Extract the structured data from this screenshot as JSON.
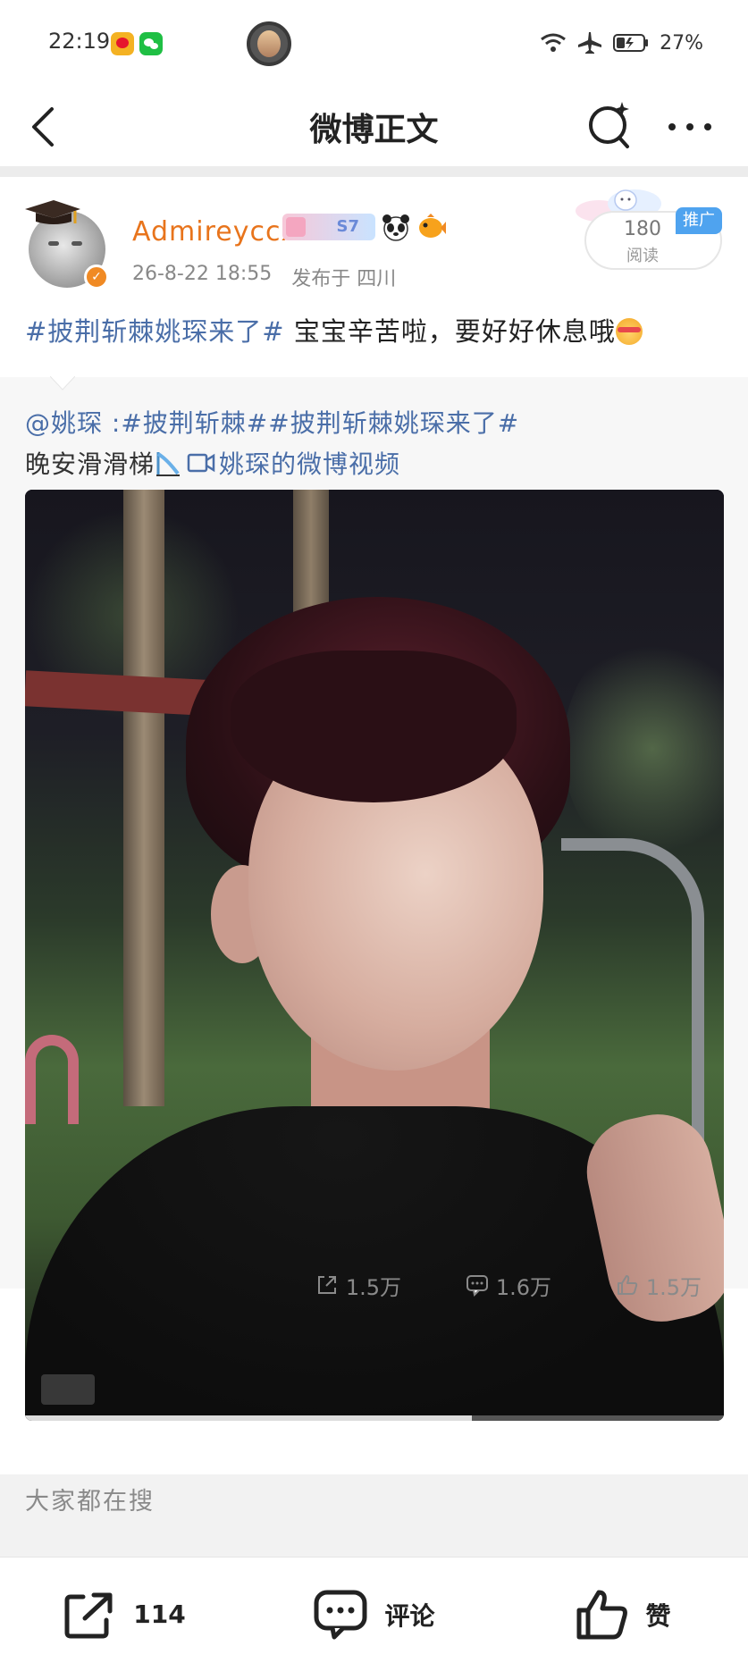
{
  "status_bar": {
    "time": "22:19",
    "battery": "27%",
    "icons": [
      "weibo-icon",
      "wechat-icon",
      "avatar-icon",
      "wifi-icon",
      "airplane-mode-icon",
      "battery-icon"
    ]
  },
  "nav": {
    "title": "微博正文",
    "icons": [
      "back-icon",
      "search-icon",
      "more-icon"
    ]
  },
  "post": {
    "username": "Admireyccx",
    "badge_text": "S7",
    "timestamp": "26-8-22 18:55",
    "location": "发布于 四川",
    "read_count": "180",
    "read_label": "阅读",
    "promo_tag": "推广",
    "hashtag": "#披荆斩棘姚琛来了#",
    "text": " 宝宝辛苦啦，要好好休息哦",
    "colors": {
      "username": "#e8741c",
      "hashtag": "#4a6ea8",
      "verified": "#f08a24"
    }
  },
  "repost": {
    "line1": "@姚琛 :#披荆斩棘##披荆斩棘姚琛来了#",
    "line2_text": "晚安滑滑梯",
    "video_link": "姚琛的微博视频",
    "video": {
      "progress": 0.64
    }
  },
  "actions": {
    "share": "1.5万",
    "comment": "1.6万",
    "like": "1.5万"
  },
  "trending": {
    "title": "大家都在搜"
  },
  "bottom_bar": {
    "share_count": "114",
    "comment_label": "评论",
    "like_label": "赞"
  }
}
